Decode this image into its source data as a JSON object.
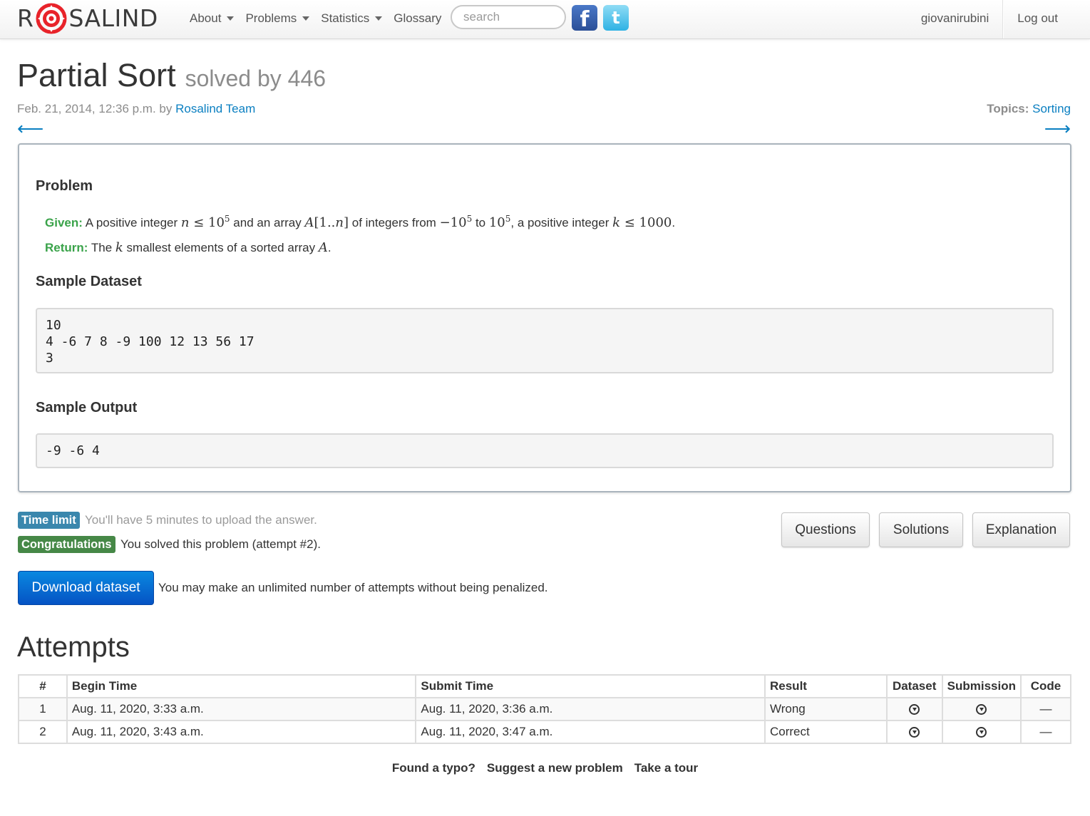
{
  "brand": {
    "prefix": "R",
    "suffix": "SALIND",
    "logo_icon": "rosalind-logo-icon"
  },
  "nav": {
    "items": [
      {
        "label": "About",
        "dropdown": true
      },
      {
        "label": "Problems",
        "dropdown": true
      },
      {
        "label": "Statistics",
        "dropdown": true
      },
      {
        "label": "Glossary",
        "dropdown": false
      }
    ],
    "search_placeholder": "search",
    "social": [
      {
        "icon": "facebook-icon",
        "glyph": "f"
      },
      {
        "icon": "twitter-icon",
        "glyph": "t"
      }
    ],
    "user": "giovanirubini",
    "logout": "Log out"
  },
  "header": {
    "title": "Partial Sort",
    "solved_by": "solved by 446",
    "date": "Feb. 21, 2014, 12:36 p.m. by",
    "author": "Rosalind Team",
    "topics_label": "Topics:",
    "topics_value": "Sorting",
    "prev_arrow": "⟵",
    "next_arrow": "⟶"
  },
  "problem": {
    "heading": "Problem",
    "given_label": "Given:",
    "return_label": "Return:",
    "sample_dataset_heading": "Sample Dataset",
    "sample_dataset": "10\n4 -6 7 8 -9 100 12 13 56 17\n3",
    "sample_output_heading": "Sample Output",
    "sample_output": "-9 -6 4"
  },
  "status": {
    "time_limit_badge": "Time limit",
    "time_limit_text": "You'll have 5 minutes to upload the answer.",
    "congrats_badge": "Congratulations",
    "congrats_text": "You solved this problem (attempt #2).",
    "buttons": {
      "questions": "Questions",
      "solutions": "Solutions",
      "explanation": "Explanation"
    },
    "download_button": "Download dataset",
    "download_note": "You may make an unlimited number of attempts without being penalized."
  },
  "attempts": {
    "heading": "Attempts",
    "columns": [
      "#",
      "Begin Time",
      "Submit Time",
      "Result",
      "Dataset",
      "Submission",
      "Code"
    ],
    "rows": [
      {
        "num": "1",
        "begin": "Aug. 11, 2020, 3:33 a.m.",
        "submit": "Aug. 11, 2020, 3:36 a.m.",
        "result": "Wrong",
        "code": "—"
      },
      {
        "num": "2",
        "begin": "Aug. 11, 2020, 3:43 a.m.",
        "submit": "Aug. 11, 2020, 3:47 a.m.",
        "result": "Correct",
        "code": "—"
      }
    ]
  },
  "footer": {
    "links": [
      "Found a typo?",
      "Suggest a new problem",
      "Take a tour"
    ]
  }
}
